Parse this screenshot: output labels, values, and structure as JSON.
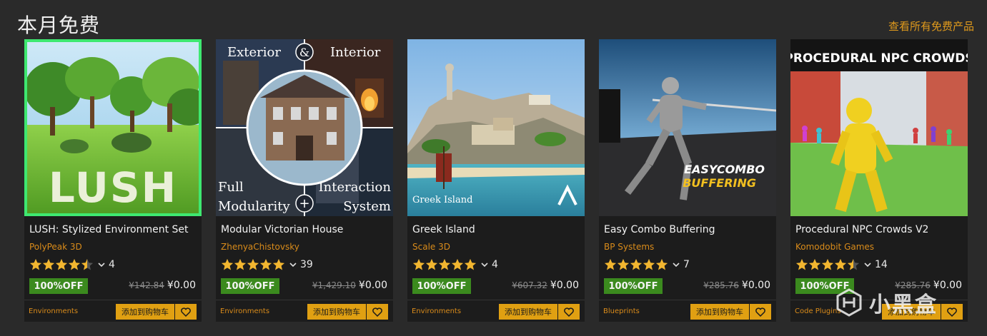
{
  "section": {
    "title": "本月免费",
    "view_all": "查看所有免费产品"
  },
  "colors": {
    "accent": "#e09a1c",
    "badge": "#3b8a1e",
    "active_border": "#3ee870",
    "star": "#f2b630"
  },
  "cards": [
    {
      "title": "LUSH: Stylized Environment Set",
      "seller": "PolyPeak 3D",
      "rating": 4.5,
      "rating_count": "4",
      "badge": "100%OFF",
      "old_price": "¥142.84",
      "price": "¥0.00",
      "category": "Environments",
      "add_to_cart": "添加到购物车",
      "thumb_text": "LUSH",
      "heart_icon": "heart-icon"
    },
    {
      "title": "Modular Victorian House",
      "seller": "ZhenyaChistovsky",
      "rating": 5,
      "rating_count": "39",
      "badge": "100%OFF",
      "old_price": "¥1,429.10",
      "price": "¥0.00",
      "category": "Environments",
      "add_to_cart": "添加到购物车",
      "thumb_labels": [
        "Exterior",
        "&",
        "Interior",
        "Full",
        "Modularity",
        "+",
        "Interaction",
        "System"
      ],
      "heart_icon": "heart-icon"
    },
    {
      "title": "Greek Island",
      "seller": "Scale 3D",
      "rating": 5,
      "rating_count": "4",
      "badge": "100%OFF",
      "old_price": "¥607.32",
      "price": "¥0.00",
      "category": "Environments",
      "add_to_cart": "添加到购物车",
      "thumb_text": "Greek Island",
      "heart_icon": "heart-icon"
    },
    {
      "title": "Easy Combo Buffering",
      "seller": "BP Systems",
      "rating": 5,
      "rating_count": "7",
      "badge": "100%OFF",
      "old_price": "¥285.76",
      "price": "¥0.00",
      "category": "Blueprints",
      "add_to_cart": "添加到购物车",
      "thumb_text_1": "EASYCOMBO",
      "thumb_text_2": "BUFFERING",
      "heart_icon": "heart-icon"
    },
    {
      "title": "Procedural NPC Crowds V2",
      "seller": "Komodobit Games",
      "rating": 4.5,
      "rating_count": "14",
      "badge": "100%OFF",
      "old_price": "¥285.76",
      "price": "¥0.00",
      "category": "Code Plugins",
      "add_to_cart": "添加到购物车",
      "thumb_text": "PROCEDURAL NPC CROWDS",
      "heart_icon": "heart-icon"
    }
  ],
  "watermark": {
    "text": "小黑盒"
  }
}
